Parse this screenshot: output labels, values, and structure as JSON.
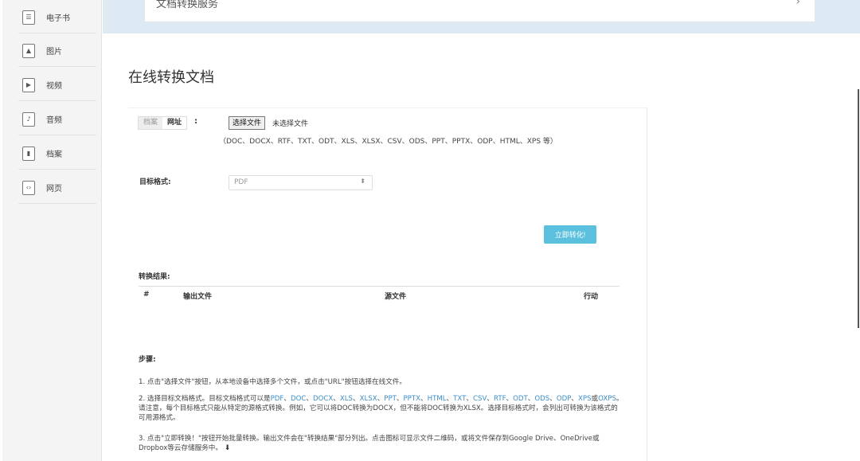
{
  "sidebar": {
    "items": [
      {
        "label": "电子书",
        "icon": "ebook-icon"
      },
      {
        "label": "图片",
        "icon": "image-icon"
      },
      {
        "label": "视频",
        "icon": "video-icon"
      },
      {
        "label": "音频",
        "icon": "audio-icon"
      },
      {
        "label": "档案",
        "icon": "archive-icon"
      },
      {
        "label": "网页",
        "icon": "webpage-icon"
      }
    ]
  },
  "banner": {
    "title": "文档转换服务",
    "chevron": "›"
  },
  "page_title": "在线转换文档",
  "source": {
    "tabs": [
      "档案",
      "网址"
    ],
    "active_tab": "网址",
    "colon": ":",
    "file_button": "选择文件",
    "file_status": "未选择文件",
    "hint": "（DOC、DOCX、RTF、TXT、ODT、XLS、XLSX、CSV、ODS、PPT、PPTX、ODP、HTML、XPS 等）"
  },
  "target": {
    "label": "目标格式:",
    "selected": "PDF",
    "arrow": "⬍"
  },
  "convert_button": "立即转化!",
  "results": {
    "label": "转换结果:",
    "columns": [
      "#",
      "输出文件",
      "源文件",
      "行动"
    ]
  },
  "steps": {
    "label": "步骤:",
    "step1": "1. 点击\"选择文件\"按钮，从本地设备中选择多个文件，或点击\"URL\"按钮选择在线文件。",
    "step2_prefix": "2. 选择目标文档格式。目标文档格式可以是",
    "step2_formats": [
      "PDF",
      "DOC",
      "DOCX",
      "XLS",
      "XLSX",
      "PPT",
      "PPTX",
      "HTML",
      "TXT",
      "CSV",
      "RTF",
      "ODT",
      "ODS",
      "ODP",
      "XPS"
    ],
    "step2_or": "或",
    "step2_last": "OXPS",
    "step2_suffix": "。请注意，每个目标格式只能从特定的源格式转换。例如，它可以将DOC转换为DOCX，但不能将DOC转换为XLSX。选择目标格式时，会列出可转换为该格式的可用源格式。",
    "step3": "3. 点击\"立即转换！\"按钮开始批量转换。输出文件会在\"转换结果\"部分列出。点击图标可显示文件二维码，或将文件保存到Google Drive、OneDrive或Dropbox等云存储服务中。",
    "download_icon": "download-icon"
  }
}
